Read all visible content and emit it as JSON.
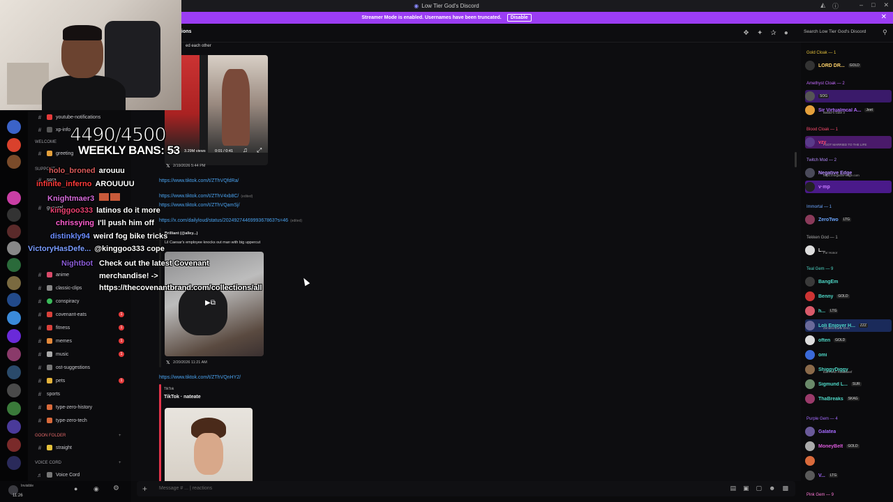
{
  "window": {
    "title": "Low Tier God's Discord"
  },
  "banner": {
    "text": "Streamer Mode is enabled. Usernames have been truncated.",
    "button": "Disable"
  },
  "header": {
    "channel_suffix": "ions",
    "search_placeholder": "Search Low Tier God's Discord"
  },
  "overlay": {
    "counter": "4490/4500",
    "bans": "WEEKLY BANS: 53",
    "chat": [
      {
        "name": "holo_broned",
        "message": "arouuu",
        "color": "#d65a5a"
      },
      {
        "name": "infinite_inferno",
        "message": "AROUUUU",
        "color": "#ff3b3b"
      },
      {
        "name": "Knightmaer3",
        "message": "",
        "color": "#d46ad9"
      },
      {
        "name": "kinggoo333",
        "message": "latinos do it more",
        "color": "#e8406f"
      },
      {
        "name": "chrissying",
        "message": "I'll push him off",
        "color": "#ff5ed1"
      },
      {
        "name": "distinkly94",
        "message": "weird fog bike tricks",
        "color": "#6b8cff"
      },
      {
        "name": "VictoryHasDefe...",
        "message": "@kinggoo333 cope",
        "color": "#7a9cff"
      },
      {
        "name": "Nightbot",
        "message": "Check out the latest Covenant merchandise! -> https://thecovenantbrand.com/collections/all",
        "color": "#8a5bd6"
      }
    ]
  },
  "sidebar": {
    "channels_top": [
      {
        "label": "youtube-notifications"
      },
      {
        "label": "xp-info"
      },
      {
        "label": "greeting"
      }
    ],
    "category_welcome": "WELCOME",
    "category_support": "SUPPORT",
    "channels": [
      {
        "label": "sora",
        "badge": ""
      },
      {
        "label": "general",
        "badge": ""
      },
      {
        "label": "anime",
        "badge": ""
      },
      {
        "label": "classic-clips",
        "badge": ""
      },
      {
        "label": "conspiracy",
        "badge": ""
      },
      {
        "label": "covenant-eats",
        "badge": "1"
      },
      {
        "label": "fitness",
        "badge": "1"
      },
      {
        "label": "memes",
        "badge": "1"
      },
      {
        "label": "music",
        "badge": "1"
      },
      {
        "label": "ost-suggestions",
        "badge": ""
      },
      {
        "label": "pets",
        "badge": "1"
      },
      {
        "label": "sports",
        "badge": ""
      },
      {
        "label": "type-zero-history",
        "badge": ""
      },
      {
        "label": "type-zero-tech",
        "badge": ""
      }
    ],
    "goon_folder": "GOON FOLDER",
    "goon_channel": "straight",
    "voice_category": "VOICE CORD",
    "voice_channel": "Voice Cord",
    "user_status": "Invisible",
    "user_time": "11:26"
  },
  "messages": {
    "top_caption": "ed each other",
    "video1": {
      "views": "3.29M views",
      "time": "0:01 / 0:41",
      "date": "2/19/2026 5:44 PM"
    },
    "links": [
      "https://www.tiktok.com/t/ZThVQfdRa/",
      "https://www.tiktok.com/t/ZThV4xb8C/",
      "https://www.tiktok.com/t/ZThVQamSj/",
      "https://x.com/dailyloud/status/2024927446999367863?s=46"
    ],
    "edited": "(edited)",
    "tweet_author": "Brilliant (@alley...)",
    "tweet_text": "Lil Caesar's employee knocks out man with big uppercut",
    "video2_date": "2/20/2026 11:21 AM",
    "link_last": "https://www.tiktok.com/t/ZThVQnHY2/",
    "tiktok_provider": "TikTok",
    "tiktok_title": "TikTok · nateate"
  },
  "members": {
    "roles": [
      {
        "header": "Gold Cloak — 1",
        "members": [
          {
            "name": "LORD DR...",
            "color": "#ffd36a",
            "tag": "GOLD",
            "sub": ""
          }
        ]
      },
      {
        "header": "Amethyst Cloak — 2",
        "members": [
          {
            "name": "",
            "color": "#c56bff",
            "tag": "SOG",
            "sub": ""
          },
          {
            "name": "Sir Virtualmcal A...",
            "color": "#b06bff",
            "tag": "Jeet",
            "sub": "Baldur's Gate 3"
          }
        ]
      },
      {
        "header": "Blood Cloak — 1",
        "members": [
          {
            "name": "vzy",
            "color": "#ff4b6e",
            "tag": "",
            "sub": "I GOT MARRIED TO THE LIFE"
          }
        ]
      },
      {
        "header": "Twitch Mod — 2",
        "members": [
          {
            "name": "Negative Edge",
            "color": "#b68bff",
            "tag": "",
            "sub": "https://negative-edge.com"
          },
          {
            "name": "v·mp",
            "color": "#c77bff",
            "tag": "",
            "sub": ""
          }
        ]
      },
      {
        "header": "Immortal — 1",
        "members": [
          {
            "name": "ZeroTwo",
            "color": "#6ba6ff",
            "tag": "LTG",
            "sub": ""
          }
        ]
      },
      {
        "header": "Tekken God — 1",
        "members": [
          {
            "name": "L...",
            "color": "#ddd",
            "tag": "",
            "sub": "For Honor"
          }
        ]
      },
      {
        "header": "Teal Gem — 9",
        "members": [
          {
            "name": "BangEm",
            "color": "#4fd9c8",
            "tag": "",
            "sub": ""
          },
          {
            "name": "Benny",
            "color": "#4fd9c8",
            "tag": "GOLD",
            "sub": ""
          },
          {
            "name": "h...",
            "color": "#4fd9c8",
            "tag": "LTG",
            "sub": ""
          },
          {
            "name": "Loli Enjoyer H...",
            "color": "#4fd9c8",
            "tag": "ZZZ",
            "sub": "Zenless Zone Zero"
          },
          {
            "name": "often",
            "color": "#4fd9c8",
            "tag": "GOLD",
            "sub": ""
          },
          {
            "name": "omi",
            "color": "#4fd9c8",
            "tag": "",
            "sub": ""
          },
          {
            "name": "ShiggyDiggy",
            "color": "#4fd9c8",
            "tag": "",
            "sub": "Eat Fresh Roastbeef"
          },
          {
            "name": "Sigmund L...",
            "color": "#4fd9c8",
            "tag": "SUR",
            "sub": ""
          },
          {
            "name": "ThaBreaks",
            "color": "#4fd9c8",
            "tag": "SKAG",
            "sub": ""
          }
        ]
      },
      {
        "header": "Purple Gem — 4",
        "members": [
          {
            "name": "Galatea",
            "color": "#a66bff",
            "tag": "",
            "sub": ""
          },
          {
            "name": "MoneyBelt",
            "color": "#a66bff",
            "tag": "GOLD",
            "sub": ""
          },
          {
            "name": "",
            "color": "#a66bff",
            "tag": "",
            "sub": ""
          },
          {
            "name": "V...",
            "color": "#a66bff",
            "tag": "LTG",
            "sub": ""
          }
        ]
      },
      {
        "header": "Pink Gem — 9",
        "members": []
      }
    ]
  },
  "composer": {
    "placeholder": "Message # ... | reactions"
  }
}
